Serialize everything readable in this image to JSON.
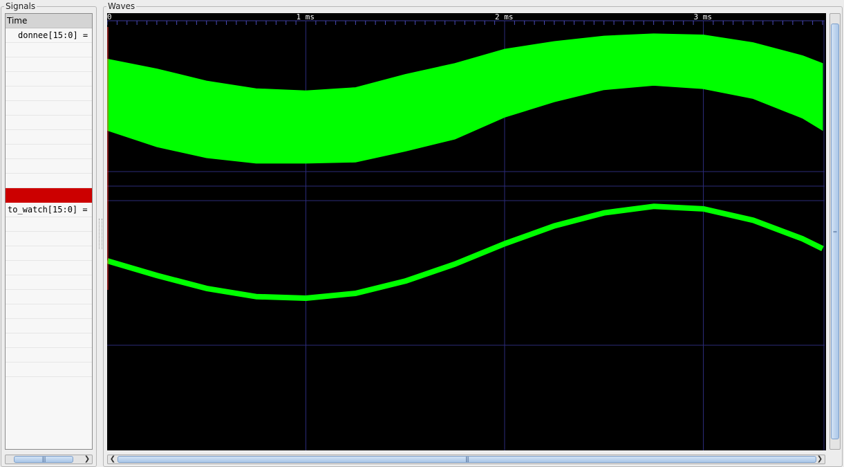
{
  "panels": {
    "signals_title": "Signals",
    "waves_title": "Waves"
  },
  "signals": {
    "header": "Time",
    "rows": [
      {
        "label": "donnee[15:0] =",
        "style": "indent"
      },
      {
        "label": "",
        "style": "blank"
      },
      {
        "label": "",
        "style": "blank"
      },
      {
        "label": "",
        "style": "blank"
      },
      {
        "label": "",
        "style": "blank"
      },
      {
        "label": "",
        "style": "blank"
      },
      {
        "label": "",
        "style": "blank"
      },
      {
        "label": "",
        "style": "blank"
      },
      {
        "label": "",
        "style": "blank"
      },
      {
        "label": "",
        "style": "blank"
      },
      {
        "label": "",
        "style": "blank"
      },
      {
        "label": "",
        "style": "highlight"
      },
      {
        "label": "to_watch[15:0] =",
        "style": "plain"
      },
      {
        "label": "",
        "style": "blank"
      },
      {
        "label": "",
        "style": "blank"
      },
      {
        "label": "",
        "style": "blank"
      },
      {
        "label": "",
        "style": "blank"
      },
      {
        "label": "",
        "style": "blank"
      },
      {
        "label": "",
        "style": "blank"
      },
      {
        "label": "",
        "style": "blank"
      },
      {
        "label": "",
        "style": "blank"
      },
      {
        "label": "",
        "style": "blank"
      },
      {
        "label": "",
        "style": "blank"
      },
      {
        "label": "",
        "style": "blank"
      }
    ]
  },
  "timeline": {
    "ticks": [
      "0",
      "1 ms",
      "2 ms",
      "3 ms"
    ],
    "tick_values_ms": [
      0,
      1,
      2,
      3
    ],
    "visible_range_ms": [
      0,
      3.6
    ]
  },
  "waveforms": [
    {
      "name": "donnee[15:0]",
      "render": "band",
      "color": "#00ff00",
      "time_ms": [
        0,
        0.25,
        0.5,
        0.75,
        1.0,
        1.25,
        1.5,
        1.75,
        2.0,
        2.25,
        2.5,
        2.75,
        3.0,
        3.25,
        3.5,
        3.6
      ],
      "upper": [
        0.72,
        0.63,
        0.52,
        0.45,
        0.43,
        0.46,
        0.58,
        0.68,
        0.81,
        0.88,
        0.93,
        0.95,
        0.94,
        0.87,
        0.75,
        0.68
      ],
      "lower": [
        0.07,
        -0.08,
        -0.18,
        -0.23,
        -0.23,
        -0.22,
        -0.12,
        -0.01,
        0.19,
        0.33,
        0.44,
        0.48,
        0.45,
        0.36,
        0.18,
        0.07
      ]
    },
    {
      "name": "to_watch[15:0]",
      "render": "line",
      "color": "#00ff00",
      "time_ms": [
        0,
        0.25,
        0.5,
        0.75,
        1.0,
        1.25,
        1.5,
        1.75,
        2.0,
        2.25,
        2.5,
        2.75,
        3.0,
        3.25,
        3.5,
        3.6
      ],
      "values": [
        0.31,
        0.13,
        -0.03,
        -0.13,
        -0.15,
        -0.09,
        0.06,
        0.27,
        0.52,
        0.74,
        0.9,
        0.98,
        0.95,
        0.81,
        0.58,
        0.46
      ]
    }
  ]
}
